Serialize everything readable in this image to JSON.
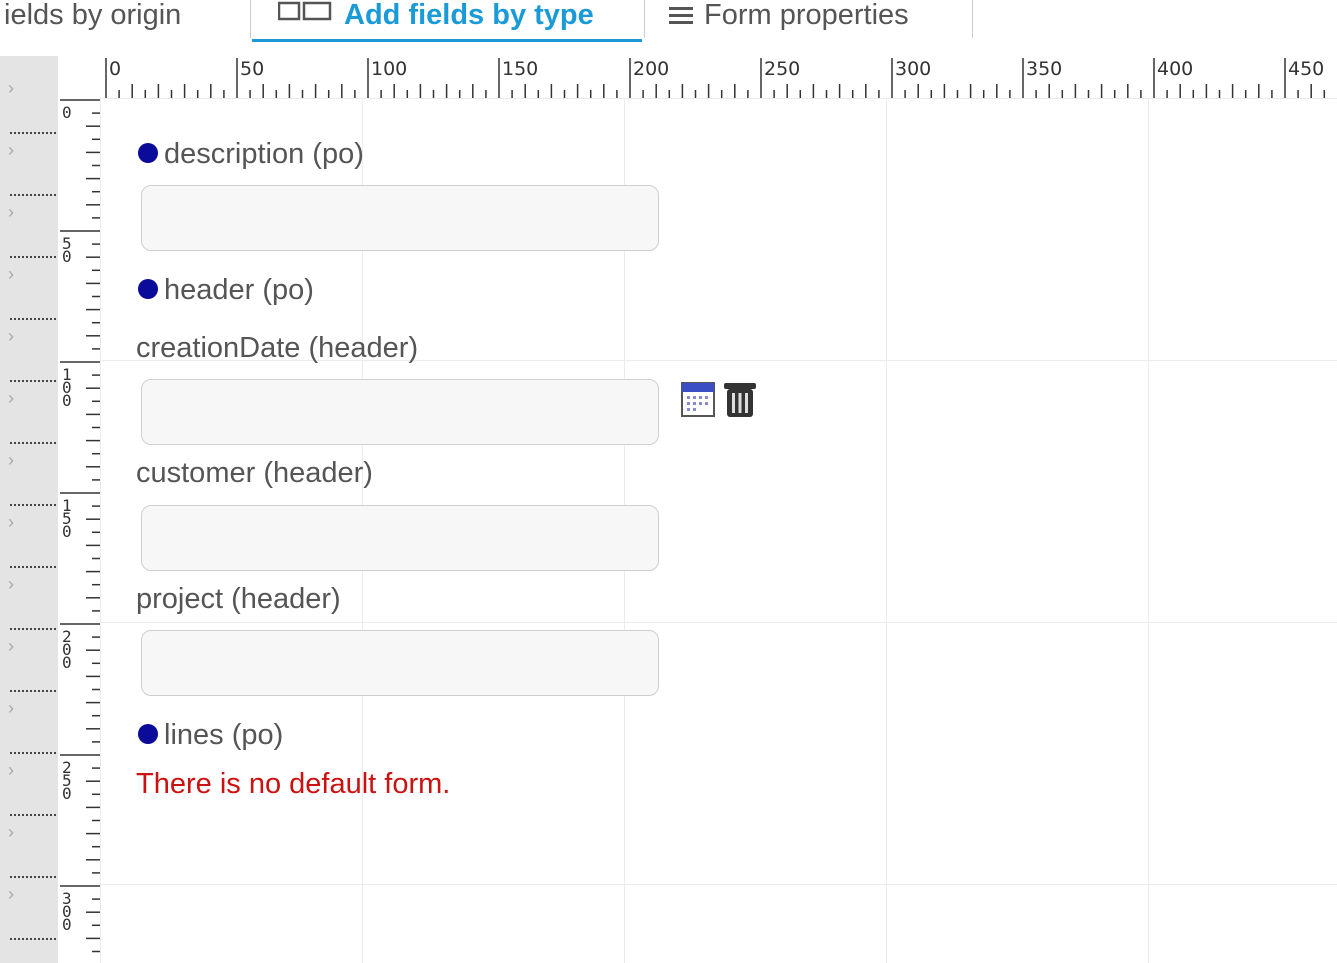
{
  "tabs": [
    {
      "label": "ields by origin"
    },
    {
      "label": "Add fields by type",
      "active": true,
      "icon": "add-field-icon"
    },
    {
      "label": "Form properties",
      "icon": "form-properties-icon"
    }
  ],
  "ruler": {
    "horizontal": [
      "0",
      "50",
      "100",
      "150",
      "200",
      "250",
      "300",
      "350",
      "400",
      "450"
    ],
    "vertical": [
      "0",
      "50",
      "100",
      "150",
      "200",
      "250",
      "300"
    ]
  },
  "form": {
    "sections": [
      {
        "label": "description (po)"
      },
      {
        "label": "header (po)"
      },
      {
        "label": "lines (po)"
      }
    ],
    "fields": [
      {
        "label": "creationDate (header)"
      },
      {
        "label": "customer (header)"
      },
      {
        "label": "project (header)"
      }
    ],
    "message": "There is no default form.",
    "field_icons": [
      "calendar-icon",
      "trash-icon"
    ]
  },
  "colors": {
    "accent": "#1a9ad6",
    "bullet": "#0b0b9a",
    "error": "#cc1111"
  }
}
